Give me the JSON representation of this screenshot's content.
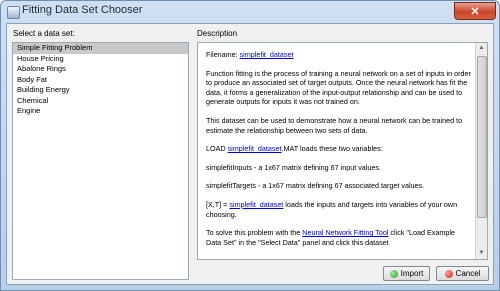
{
  "window": {
    "title": "Fitting Data Set Chooser",
    "close_glyph": "✕"
  },
  "left_panel": {
    "label": "Select a data set:",
    "items": [
      {
        "label": "Simple Fitting Problem",
        "selected": true
      },
      {
        "label": "House Pricing"
      },
      {
        "label": "Abalone Rings"
      },
      {
        "label": "Body Fat"
      },
      {
        "label": "Building Energy"
      },
      {
        "label": "Chemical"
      },
      {
        "label": "Engine"
      }
    ]
  },
  "description": {
    "label": "Description",
    "filename_prefix": "Filename: ",
    "filename_link": "simplefit_dataset",
    "para1": "Function fitting is the process of training a neural network on a set of inputs in order to produce an associated set of target outputs. Once the neural network has fit the data, it forms a generalization of the input-output relationship and can be used to generate outputs for inputs it was not trained on.",
    "para2": "This dataset can be used to demonstrate how a neural network can be trained to estimate the relationship between two sets of data.",
    "load_prefix": "LOAD ",
    "load_link": "simplefit_dataset",
    "load_suffix": ".MAT loads these two variables:",
    "inputs_text": "simplefitInputs - a 1x67 matrix defining 67 input values.",
    "targets_text": "simplefitTargets - a 1x67 matrix defining 67 associated target values.",
    "xt_prefix": "[X,T] = ",
    "xt_link": "simplefit_dataset",
    "xt_suffix": " loads the inputs and targets into variables of your own choosing.",
    "solve_prefix": "To solve this problem with the ",
    "solve_link": "Neural Network Fitting Tool",
    "solve_suffix": " click \"Load Example Data Set\" in the \"Select Data\" panel and click this dataset"
  },
  "buttons": {
    "import_label": "Import",
    "cancel_label": "Cancel"
  },
  "icons": {
    "import": "import-icon",
    "cancel": "cancel-icon",
    "scroll_up": "▲",
    "scroll_down": "▼"
  }
}
